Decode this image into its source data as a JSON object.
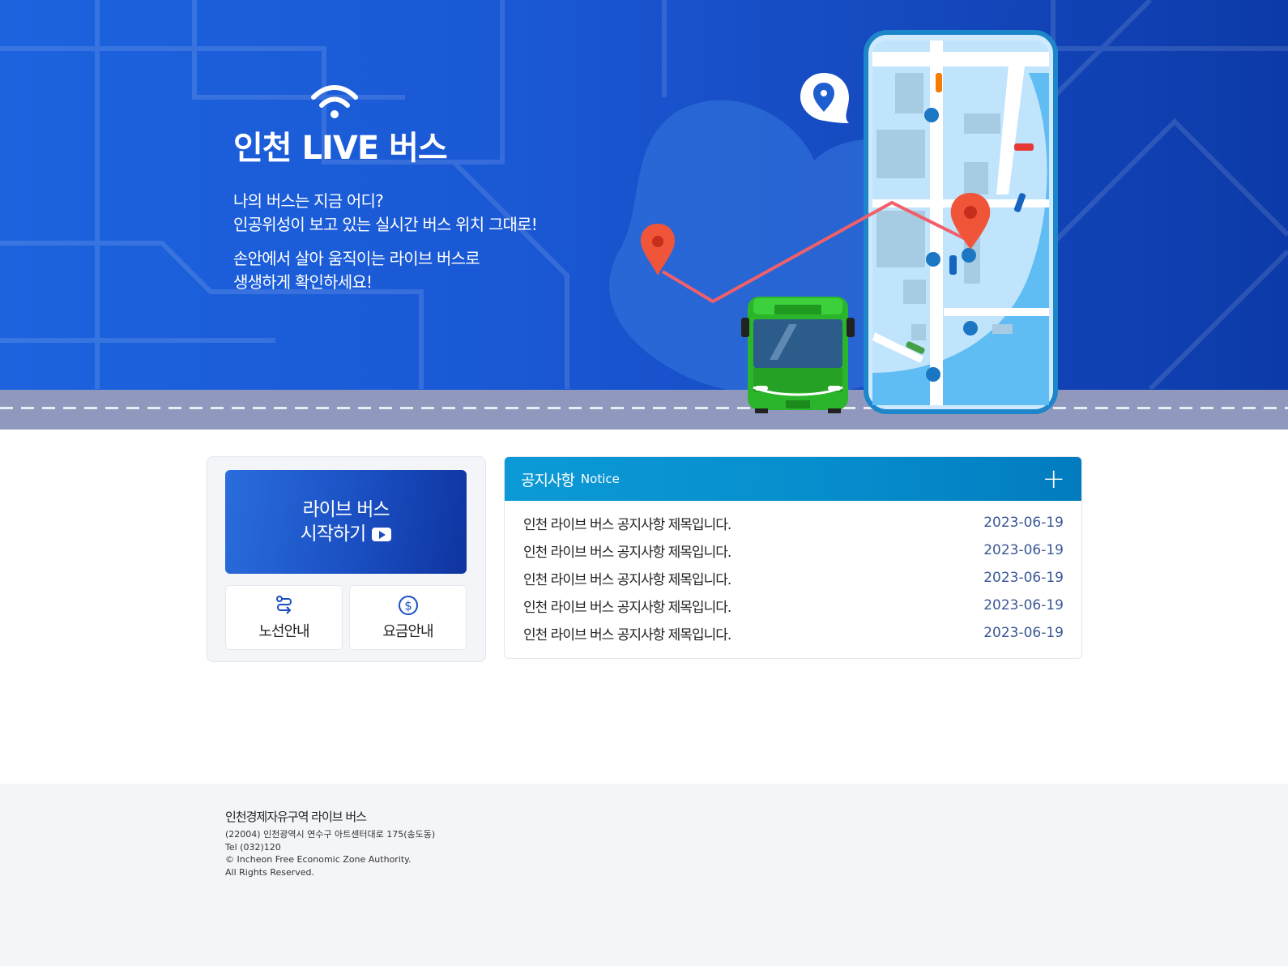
{
  "hero": {
    "title": "인천 LIVE 버스",
    "desc_line1": "나의 버스는 지금 어디?",
    "desc_line2": "인공위성이 보고 있는 실시간 버스 위치 그대로!",
    "desc_line3": "손안에서 살아 움직이는 라이브 버스로",
    "desc_line4": "생생하게 확인하세요!"
  },
  "quick": {
    "start_line1": "라이브 버스",
    "start_line2": "시작하기",
    "route_label": "노선안내",
    "fare_label": "요금안내"
  },
  "notice": {
    "title_ko": "공지사항",
    "title_en": "Notice",
    "more_label": "+",
    "items": [
      {
        "title": "인천 라이브 버스 공지사항 제목입니다.",
        "date": "2023-06-19"
      },
      {
        "title": "인천 라이브 버스 공지사항 제목입니다.",
        "date": "2023-06-19"
      },
      {
        "title": "인천 라이브 버스 공지사항 제목입니다.",
        "date": "2023-06-19"
      },
      {
        "title": "인천 라이브 버스 공지사항 제목입니다.",
        "date": "2023-06-19"
      },
      {
        "title": "인천 라이브 버스 공지사항 제목입니다.",
        "date": "2023-06-19"
      }
    ]
  },
  "footer": {
    "org": "인천경제자유구역 라이브 버스",
    "address": "(22004) 인천광역시 연수구 아트센터대로 175(송도동)",
    "tel": "Tel (032)120",
    "copyright": "© Incheon Free Economic Zone Authority.",
    "rights": "All Rights Reserved."
  },
  "colors": {
    "hero_blue": "#1a58d4",
    "notice_header": "#068ccc",
    "bus_green": "#2bb52b",
    "pin_red": "#f0553a",
    "route_line": "#f0606a"
  }
}
